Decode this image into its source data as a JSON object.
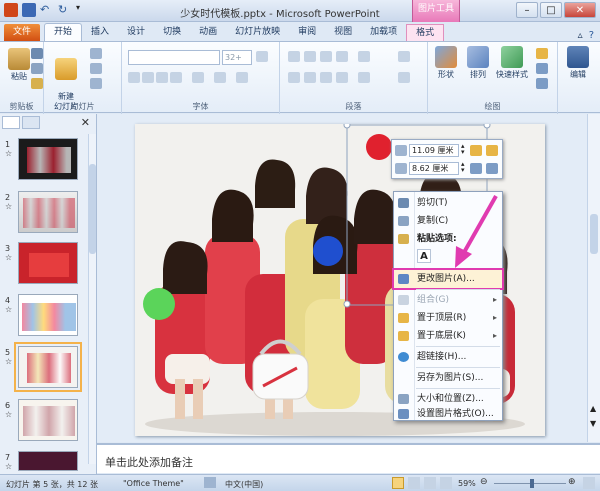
{
  "app": {
    "title": "少女时代模板.pptx - Microsoft PowerPoint",
    "contextual_group": "图片工具"
  },
  "tabs": [
    "文件",
    "开始",
    "插入",
    "设计",
    "切换",
    "动画",
    "幻灯片放映",
    "审阅",
    "视图",
    "加载项",
    "格式"
  ],
  "ribbon": {
    "clipboard": {
      "label": "剪贴板",
      "paste": "粘贴"
    },
    "slides": {
      "label": "幻灯片",
      "new_slide": "新建\n幻灯片"
    },
    "font": {
      "label": "字体",
      "size": "32+"
    },
    "paragraph": {
      "label": "段落"
    },
    "drawing": {
      "label": "绘图",
      "shape": "形状",
      "arrange": "排列",
      "quick_styles": "快速样式"
    },
    "editing": {
      "edit": "编辑"
    }
  },
  "slides_panel": {
    "thumbs": [
      {
        "num": "1",
        "marker": "☆"
      },
      {
        "num": "2",
        "marker": "☆"
      },
      {
        "num": "3",
        "marker": "☆"
      },
      {
        "num": "4",
        "marker": "☆"
      },
      {
        "num": "5",
        "marker": "☆"
      },
      {
        "num": "6",
        "marker": "☆"
      },
      {
        "num": "7",
        "marker": "☆"
      }
    ]
  },
  "mini_toolbar": {
    "height": "11.09 厘米",
    "width": "8.62 厘米"
  },
  "context_menu": {
    "cut": "剪切(T)",
    "copy": "复制(C)",
    "paste_options": "粘贴选项:",
    "change_picture": "更改图片(A)...",
    "group": "组合(G)",
    "bring_front": "置于顶层(R)",
    "send_back": "置于底层(K)",
    "hyperlink": "超链接(H)...",
    "save_as_picture": "另存为图片(S)...",
    "size_position": "大小和位置(Z)...",
    "format_picture": "设置图片格式(O)..."
  },
  "notes": {
    "placeholder": "单击此处添加备注"
  },
  "status": {
    "slide_info": "幻灯片 第 5 张，共 12 张",
    "theme": "\"Office Theme\"",
    "language": "中文(中国)",
    "zoom": "59%"
  },
  "colors": {
    "accent_pink": "#e03bb0",
    "file_tab": "#d24f12",
    "ribbon_bg": "#e4edf8"
  }
}
